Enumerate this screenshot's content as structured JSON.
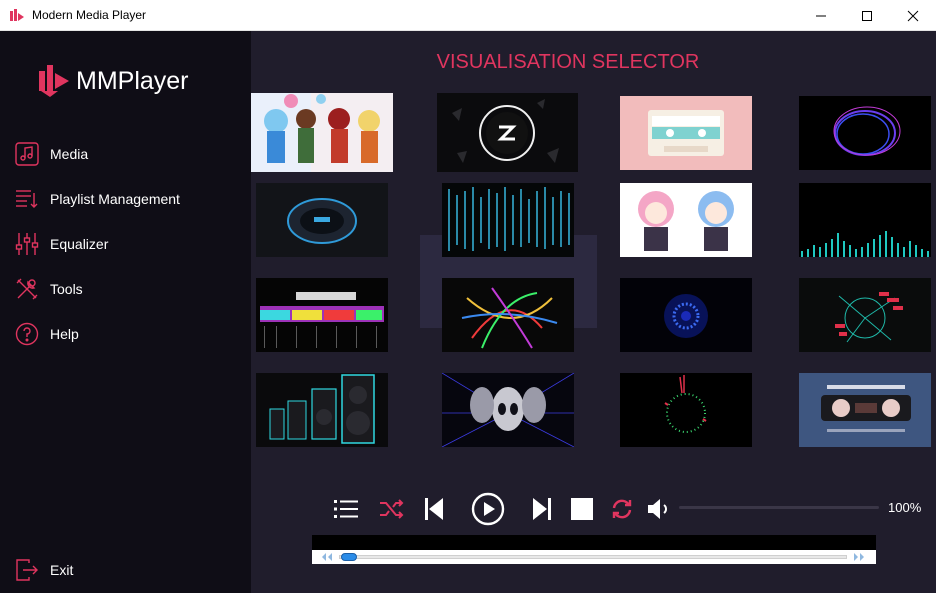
{
  "window": {
    "title": "Modern Media Player",
    "minimize_icon": "minimize-icon",
    "maximize_icon": "maximize-icon",
    "close_icon": "close-icon"
  },
  "sidebar": {
    "logo_text": "MMPlayer",
    "items": [
      {
        "label": "Media",
        "icon": "music-note-icon"
      },
      {
        "label": "Playlist Management",
        "icon": "playlist-icon"
      },
      {
        "label": "Equalizer",
        "icon": "sliders-icon"
      },
      {
        "label": "Tools",
        "icon": "tools-icon"
      },
      {
        "label": "Help",
        "icon": "help-icon"
      }
    ],
    "exit_label": "Exit"
  },
  "main": {
    "title": "VISUALISATION SELECTOR",
    "thumbnails": [
      "anime-group",
      "logo-ring",
      "cassette-pink",
      "purple-ring",
      "blue-speaker",
      "matrix-grid",
      "anime-twins",
      "cyan-bars",
      "i-love-music",
      "rainbow-tangle",
      "blue-particles",
      "red-radial",
      "speakers-neon",
      "alien-heads",
      "circle-spectrum",
      "cassette-blue"
    ]
  },
  "controls": {
    "volume_text": "100%",
    "volume_level": 1.0,
    "seek_position": 0.0
  },
  "colors": {
    "accent": "#e0355f",
    "sidebar_bg": "#0f0d16",
    "main_bg": "#201d2c"
  }
}
